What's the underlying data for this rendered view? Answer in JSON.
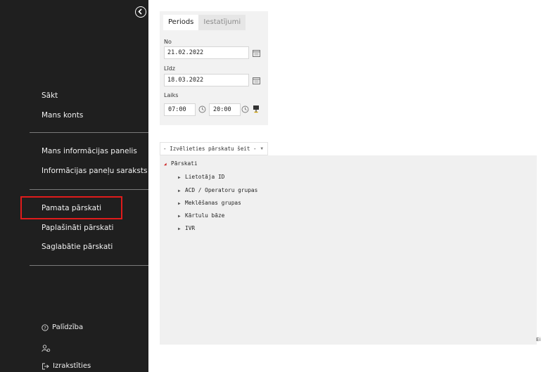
{
  "sidebar": {
    "top_items": [
      "Sākt",
      "Mans konts"
    ],
    "dash_items": [
      "Mans informācijas panelis",
      "Informācijas paneļu saraksts"
    ],
    "report_items": [
      "Pamata pārskati",
      "Paplašināti pārskati",
      "Saglabātie pārskati"
    ],
    "help": "Palīdzība",
    "logout": "Izrakstīties"
  },
  "panel": {
    "tabs": [
      "Periods",
      "Iestatījumi"
    ],
    "from_label": "No",
    "from_value": "21.02.2022",
    "to_label": "Līdz",
    "to_value": "18.03.2022",
    "time_label": "Laiks",
    "time_from": "07:00",
    "time_to": "20:00"
  },
  "report_select": {
    "value": "- Izvēlieties pārskatu šeit -"
  },
  "tree": {
    "root": "Pārskati",
    "children": [
      "Lietotāja ID",
      "ACD / Operatoru grupas",
      "Meklēšanas grupas",
      "Kārtulu bāze",
      "IVR"
    ]
  },
  "corner_text": "Ei",
  "colors": {
    "sidebar_bg": "#1f1f1f",
    "highlight": "#e01b1b",
    "tree_arrow_root": "#cc2222"
  }
}
